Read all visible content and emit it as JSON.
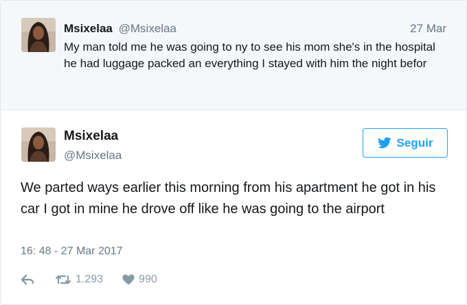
{
  "parent_tweet": {
    "name": "Msixelaa",
    "handle": "@Msixelaa",
    "date": "27 Mar",
    "text": "My man told me he was going to ny to see his mom she's in the hospital he had luggage packed an everything I stayed with him the night befor"
  },
  "main_tweet": {
    "name": "Msixelaa",
    "handle": "@Msixelaa",
    "follow_label": "Seguir",
    "text": "We parted ways earlier this morning from his apartment he got in his car I got in mine he drove off like he was going to the airport",
    "timestamp": "16: 48 - 27 Mar 2017",
    "retweet_count": "1.293",
    "like_count": "990"
  },
  "icons": {
    "reply": "reply-icon",
    "retweet": "retweet-icon",
    "like": "heart-icon",
    "bird": "twitter-bird-icon"
  },
  "colors": {
    "accent": "#1da1f2",
    "parent_background": "#f5f8fa",
    "muted_text": "#657786",
    "action_icons": "#8899a6"
  }
}
